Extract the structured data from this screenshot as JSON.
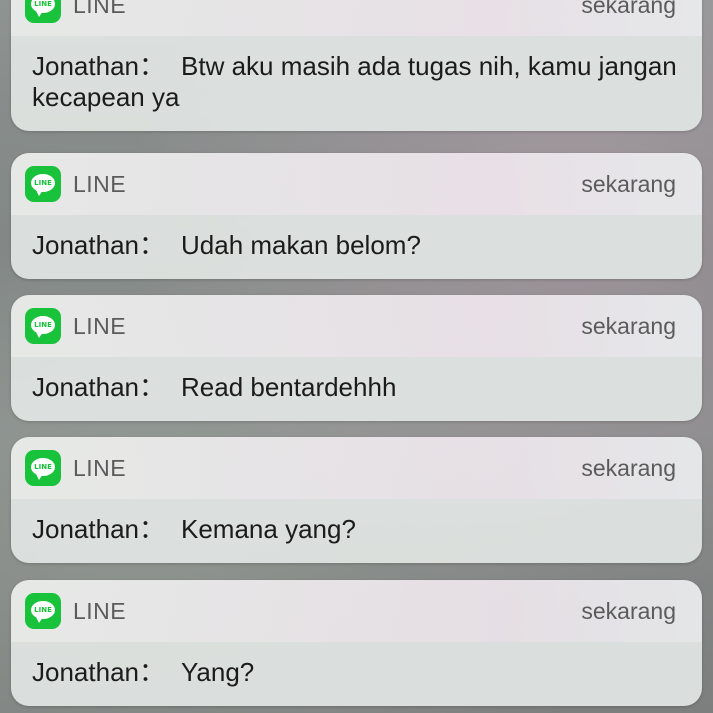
{
  "notifications": [
    {
      "app": "LINE",
      "app_icon": "line-icon",
      "icon_text": "LINE",
      "time": "sekarang",
      "sender": "Jonathan",
      "separator": "：",
      "message": "Btw aku masih ada tugas nih, kamu jangan kecapean ya"
    },
    {
      "app": "LINE",
      "app_icon": "line-icon",
      "icon_text": "LINE",
      "time": "sekarang",
      "sender": "Jonathan",
      "separator": "：",
      "message": "Udah makan belom?"
    },
    {
      "app": "LINE",
      "app_icon": "line-icon",
      "icon_text": "LINE",
      "time": "sekarang",
      "sender": "Jonathan",
      "separator": "：",
      "message": "Read bentardehhh"
    },
    {
      "app": "LINE",
      "app_icon": "line-icon",
      "icon_text": "LINE",
      "time": "sekarang",
      "sender": "Jonathan",
      "separator": "：",
      "message": "Kemana yang?"
    },
    {
      "app": "LINE",
      "app_icon": "line-icon",
      "icon_text": "LINE",
      "time": "sekarang",
      "sender": "Jonathan",
      "separator": "：",
      "message": "Yang?"
    }
  ],
  "colors": {
    "line_green": "#18c23a"
  }
}
